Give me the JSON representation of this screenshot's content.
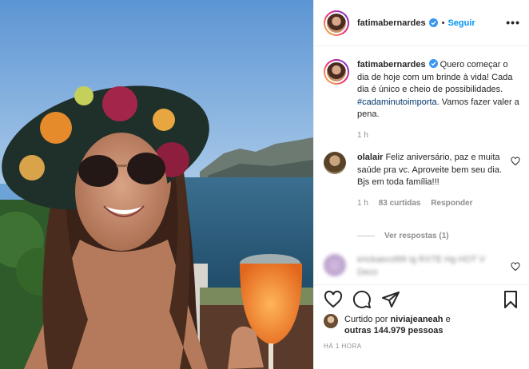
{
  "post": {
    "username": "fatimabernardes",
    "separator": "•",
    "follow_label": "Seguir",
    "more_label": "•••"
  },
  "caption": {
    "username": "fatimabernardes",
    "text_before": " Quero começar o dia de hoje com um brinde à vida! Cada dia é único e cheio de possibilidades. ",
    "hashtag": "#cadaminutoimporta",
    "text_after": ". Vamos fazer valer a pena.",
    "time": "1 h"
  },
  "comment": {
    "username": "olalair",
    "text": " Feliz aniversário, paz e muita saúde pra vc. Aproveite bem seu dia. Bjs em toda família!!!",
    "time": "1 h",
    "likes": "83 curtidas",
    "reply_label": "Responder",
    "view_replies": "Ver respostas (1)"
  },
  "blurred_comment": {
    "text": "erickaecol99 Ig RXTE Hg HOT V Deco"
  },
  "actions": {
    "liked_by_prefix": "Curtido por ",
    "liked_by_user": "niviajeaneah",
    "liked_by_mid": " e",
    "others": "outras 144.979 pessoas",
    "timestamp": "HÁ 1 HORA"
  },
  "icons": [
    "verified-icon",
    "heart-icon",
    "comment-icon",
    "share-icon",
    "bookmark-icon"
  ],
  "colors": {
    "link_blue": "#0095f6",
    "hashtag": "#00376b",
    "muted": "#8e8e8e",
    "text": "#262626"
  }
}
